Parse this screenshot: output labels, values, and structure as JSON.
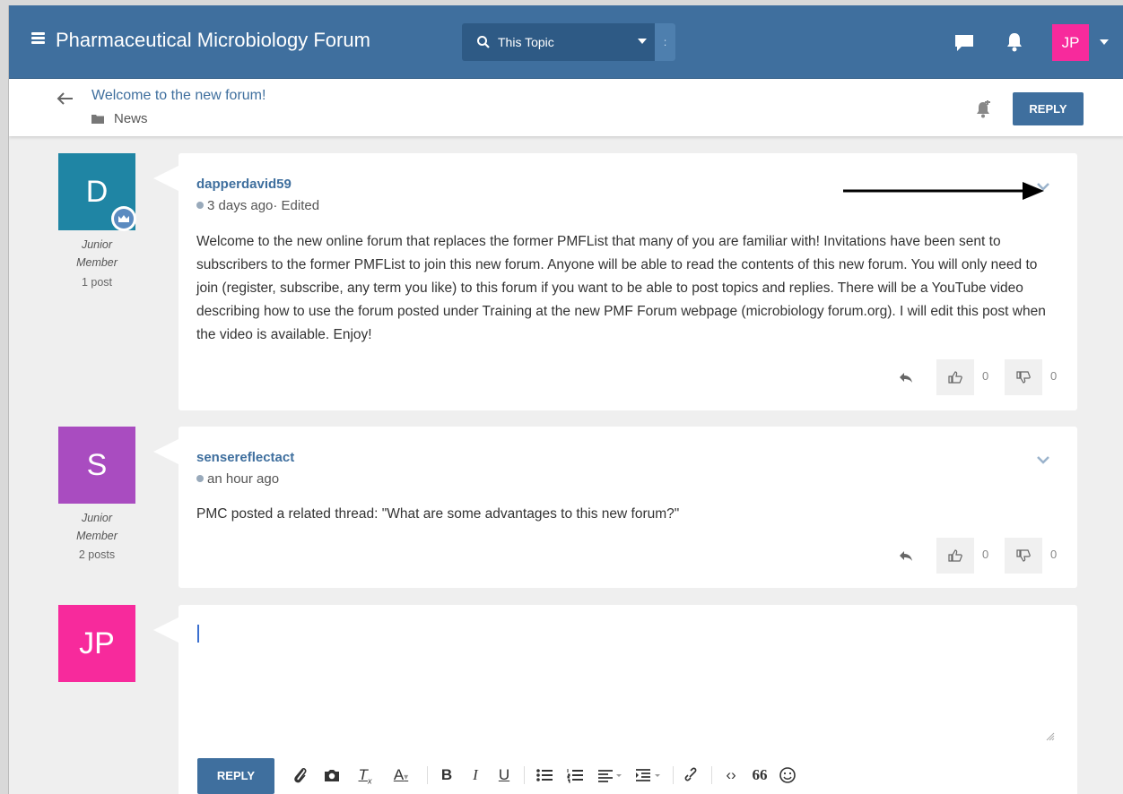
{
  "header": {
    "brand": "Pharmaceutical Microbiology Forum",
    "search_scope": "This Topic",
    "search_more": ":",
    "user_initials": "JP",
    "colors": {
      "bar": "#3f6f9e",
      "user_avatar": "#f72a9c"
    }
  },
  "topic": {
    "title": "Welcome to the new forum!",
    "category": "News",
    "reply_label": "REPLY"
  },
  "posts": [
    {
      "avatar_letter": "D",
      "avatar_color": "#1f85a4",
      "role_line1": "Junior",
      "role_line2": "Member",
      "post_count": "1 post",
      "username": "dapperdavid59",
      "meta": "3 days ago· Edited",
      "body": "Welcome to the new online forum that replaces the former PMFList that many of you are familiar with! Invitations have been sent to subscribers to the former PMFList to join this new forum. Anyone will be able to read the contents of this new forum. You will only need to join (register, subscribe, any term you like) to this forum if you want to be able to post topics and replies. There will be a YouTube video describing how to use the forum posted under Training at the new PMF Forum webpage (microbiology forum.org). I will edit this post when the video is available. Enjoy!",
      "upvotes": "0",
      "downvotes": "0"
    },
    {
      "avatar_letter": "S",
      "avatar_color": "#a94cc0",
      "role_line1": "Junior",
      "role_line2": "Member",
      "post_count": "2 posts",
      "username": "sensereflectact",
      "meta": "an hour ago",
      "body": "PMC posted a related thread: \"What are some advantages to this new forum?\"",
      "upvotes": "0",
      "downvotes": "0"
    }
  ],
  "composer": {
    "avatar_initials": "JP",
    "reply_label": "REPLY",
    "toolbar_icons": [
      "paperclip-icon",
      "camera-icon",
      "clear-format-icon",
      "text-color-icon",
      "bold-icon",
      "italic-icon",
      "underline-icon",
      "bullet-list-icon",
      "numbered-list-icon",
      "align-icon",
      "indent-icon",
      "link-icon",
      "code-icon",
      "quote-icon",
      "emoji-icon"
    ],
    "bold": "B",
    "italic": "I",
    "underline": "U",
    "code": "‹›",
    "quote": "66"
  }
}
